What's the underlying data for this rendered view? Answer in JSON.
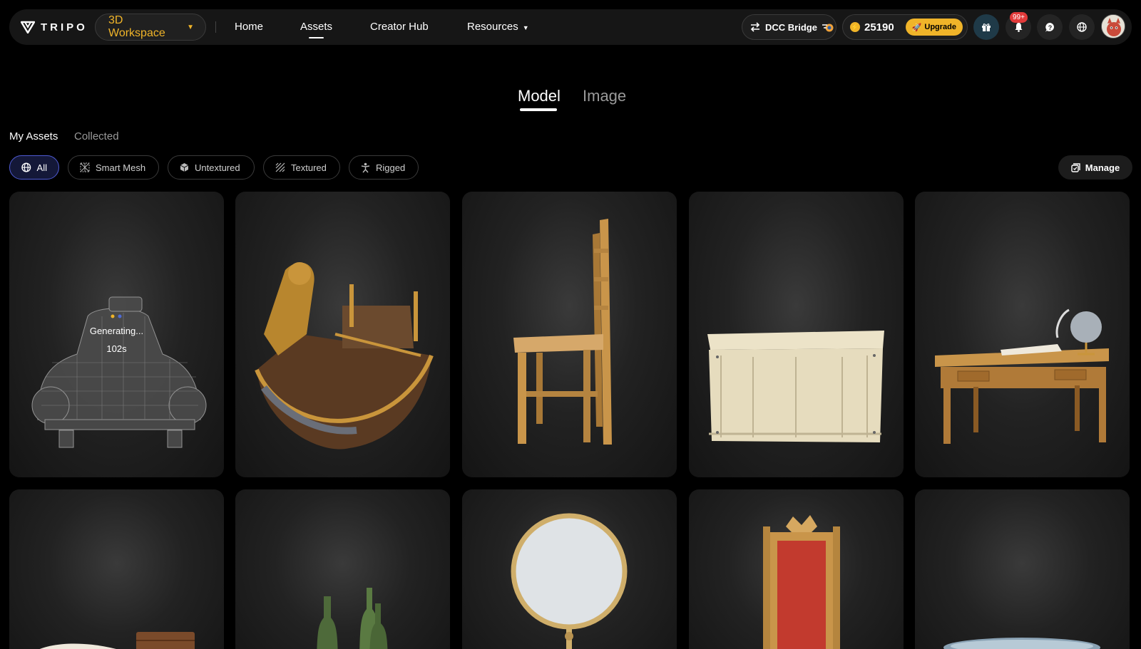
{
  "header": {
    "logo_text": "TRIPO",
    "workspace_label": "3D Workspace",
    "nav": [
      {
        "label": "Home"
      },
      {
        "label": "Assets"
      },
      {
        "label": "Creator Hub"
      },
      {
        "label": "Resources"
      }
    ],
    "active_nav": "Assets",
    "dcc_label": "DCC Bridge",
    "credits": "25190",
    "upgrade_label": "Upgrade",
    "notification_badge": "99+",
    "icons": [
      "transfer-icon",
      "coin-icon",
      "rocket-icon",
      "gift-icon",
      "bell-icon",
      "help-icon",
      "globe-icon"
    ]
  },
  "main_tabs": [
    {
      "label": "Model"
    },
    {
      "label": "Image"
    }
  ],
  "active_main_tab": "Model",
  "sub_tabs": [
    {
      "label": "My Assets"
    },
    {
      "label": "Collected"
    }
  ],
  "active_sub_tab": "My Assets",
  "filters": [
    {
      "label": "All",
      "icon": "globe-icon"
    },
    {
      "label": "Smart Mesh",
      "icon": "mesh-icon"
    },
    {
      "label": "Untextured",
      "icon": "cube-icon"
    },
    {
      "label": "Textured",
      "icon": "hatch-icon"
    },
    {
      "label": "Rigged",
      "icon": "figure-icon"
    }
  ],
  "active_filter": "All",
  "manage_label": "Manage",
  "assets": [
    {
      "subject": "wireframe car",
      "status": "Generating...",
      "timer": "102s"
    },
    {
      "subject": "ornate boat"
    },
    {
      "subject": "wooden chair"
    },
    {
      "subject": "wooden crate"
    },
    {
      "subject": "desk with globe"
    },
    {
      "subject": "open book and chest"
    },
    {
      "subject": "green bottles"
    },
    {
      "subject": "round mirror"
    },
    {
      "subject": "red throne"
    },
    {
      "subject": "water basin"
    }
  ],
  "colors": {
    "accent": "#f0b429",
    "active_filter_border": "#4f5bd5",
    "badge": "#e23a3a"
  }
}
